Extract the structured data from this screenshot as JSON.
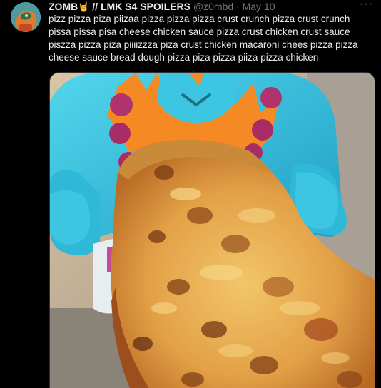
{
  "tweet": {
    "display_name": "ZOMB",
    "name_suffix": " // LMK S4 SPOILERS",
    "emoji_icon": "rock-hand-emoji",
    "handle": "@z0mbd",
    "separator": "·",
    "timestamp": "May 10",
    "more_icon": "more-horizontal-icon",
    "text": "pizz pizza piza piizaa pizza pizza pizza crust crunch pizza crust crunch pissa pissa pisa cheese chicken sauce pizza crust chicken crust sauce piszza pizza piza piiiizzza piza crust chicken macaroni chees pizza pizza cheese sauce bread dough pizza piza pizza piiza pizza chicken"
  },
  "colors": {
    "background": "#000000",
    "text_primary": "#e7e9ea",
    "text_secondary": "#71767b",
    "emoji": "#f5b800"
  }
}
